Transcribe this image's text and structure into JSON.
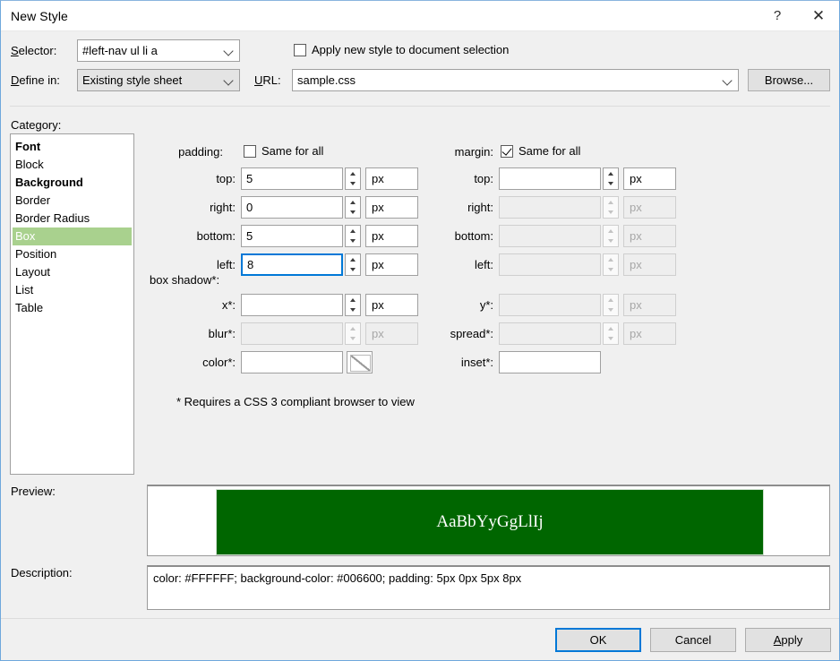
{
  "window": {
    "title": "New Style",
    "help_icon": "question-mark-icon",
    "close_icon": "close-x-icon"
  },
  "header": {
    "selector_label": "Selector:",
    "selector_value": "#left-nav ul li a",
    "define_in_label": "Define in:",
    "define_in_value": "Existing style sheet",
    "url_label": "URL:",
    "url_value": "sample.css",
    "browse_label": "Browse...",
    "apply_checkbox_label": "Apply new style to document selection",
    "apply_checkbox_checked": false
  },
  "category": {
    "label": "Category:",
    "items": [
      {
        "label": "Font",
        "bold": true,
        "selected": false
      },
      {
        "label": "Block",
        "bold": false,
        "selected": false
      },
      {
        "label": "Background",
        "bold": true,
        "selected": false
      },
      {
        "label": "Border",
        "bold": false,
        "selected": false
      },
      {
        "label": "Border Radius",
        "bold": false,
        "selected": false
      },
      {
        "label": "Box",
        "bold": false,
        "selected": true
      },
      {
        "label": "Position",
        "bold": false,
        "selected": false
      },
      {
        "label": "Layout",
        "bold": false,
        "selected": false
      },
      {
        "label": "List",
        "bold": false,
        "selected": false
      },
      {
        "label": "Table",
        "bold": false,
        "selected": false
      }
    ],
    "selected_color": "#A9D18E"
  },
  "box": {
    "padding": {
      "label": "padding:",
      "same_for_all_label": "Same for all",
      "same_for_all_checked": false,
      "rows": [
        {
          "label": "top:",
          "value": "5",
          "unit": "px",
          "enabled": true,
          "focused": false
        },
        {
          "label": "right:",
          "value": "0",
          "unit": "px",
          "enabled": true,
          "focused": false
        },
        {
          "label": "bottom:",
          "value": "5",
          "unit": "px",
          "enabled": true,
          "focused": false
        },
        {
          "label": "left:",
          "value": "8",
          "unit": "px",
          "enabled": true,
          "focused": true
        }
      ]
    },
    "margin": {
      "label": "margin:",
      "same_for_all_label": "Same for all",
      "same_for_all_checked": true,
      "rows": [
        {
          "label": "top:",
          "value": "",
          "unit": "px",
          "enabled": true,
          "focused": false
        },
        {
          "label": "right:",
          "value": "",
          "unit": "px",
          "enabled": false,
          "focused": false
        },
        {
          "label": "bottom:",
          "value": "",
          "unit": "px",
          "enabled": false,
          "focused": false
        },
        {
          "label": "left:",
          "value": "",
          "unit": "px",
          "enabled": false,
          "focused": false
        }
      ]
    },
    "box_shadow": {
      "label": "box shadow*:",
      "left_rows": [
        {
          "label": "x*:",
          "value": "",
          "unit": "px",
          "enabled": true,
          "kind": "number"
        },
        {
          "label": "blur*:",
          "value": "",
          "unit": "px",
          "enabled": false,
          "kind": "number"
        },
        {
          "label": "color*:",
          "value": "",
          "unit": "",
          "enabled": true,
          "kind": "color"
        }
      ],
      "right_rows": [
        {
          "label": "y*:",
          "value": "",
          "unit": "px",
          "enabled": false,
          "kind": "number"
        },
        {
          "label": "spread*:",
          "value": "",
          "unit": "px",
          "enabled": false,
          "kind": "number"
        },
        {
          "label": "inset*:",
          "value": "",
          "unit": "",
          "enabled": true,
          "kind": "plain"
        }
      ]
    },
    "footnote": "* Requires a CSS 3 compliant browser to view"
  },
  "preview": {
    "label": "Preview:",
    "sample_text": "AaBbYyGgLlIj",
    "background_color": "#006600",
    "text_color": "#FFFFFF"
  },
  "description": {
    "label": "Description:",
    "text": "color: #FFFFFF; background-color: #006600; padding: 5px 0px 5px 8px"
  },
  "footer": {
    "ok_label": "OK",
    "cancel_label": "Cancel",
    "apply_label": "Apply"
  }
}
